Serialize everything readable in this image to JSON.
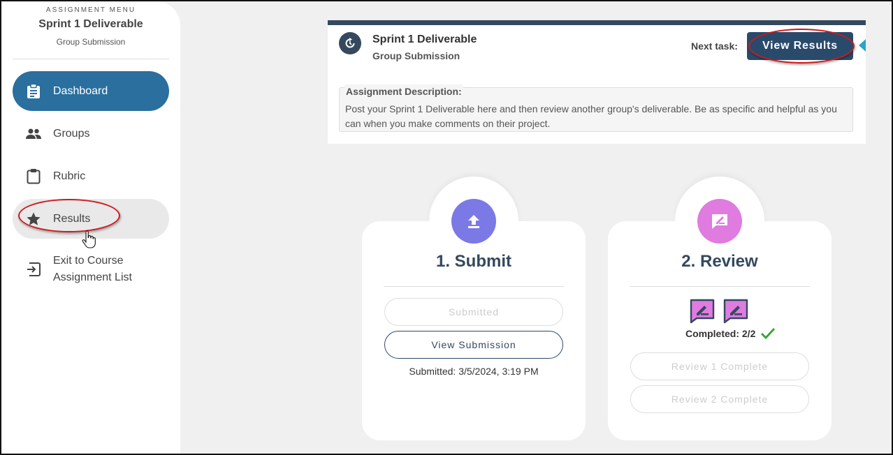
{
  "sidebar": {
    "menu_label": "ASSIGNMENT MENU",
    "title": "Sprint 1 Deliverable",
    "subtitle": "Group Submission",
    "items": [
      {
        "label": "Dashboard",
        "icon": "clipboard-text-icon",
        "active": true
      },
      {
        "label": "Groups",
        "icon": "people-icon"
      },
      {
        "label": "Rubric",
        "icon": "clipboard-icon"
      },
      {
        "label": "Results",
        "icon": "star-icon",
        "hovered": true
      },
      {
        "label": "Exit to Course Assignment List",
        "icon": "exit-icon"
      }
    ]
  },
  "assignment": {
    "title": "Sprint 1 Deliverable",
    "subtitle": "Group Submission",
    "next_task_label": "Next task:",
    "next_task_button": "View Results",
    "description_label": "Assignment Description:",
    "description": "Post your Sprint 1 Deliverable here and then review another group's deliverable. Be as specific and helpful as you can when you make comments on their project."
  },
  "steps": {
    "submit": {
      "title": "1. Submit",
      "status_button": "Submitted",
      "view_button": "View Submission",
      "submitted_text": "Submitted: 3/5/2024, 3:19 PM"
    },
    "review": {
      "title": "2. Review",
      "completed_text": "Completed: 2/2",
      "review1_button": "Review 1 Complete",
      "review2_button": "Review 2 Complete"
    }
  },
  "colors": {
    "accent": "#2a6f9e",
    "header_bar": "#34495e",
    "submit_icon": "#7b79e6",
    "review_icon": "#e07be0",
    "check": "#3aa53a",
    "annotation": "#d0191c"
  }
}
